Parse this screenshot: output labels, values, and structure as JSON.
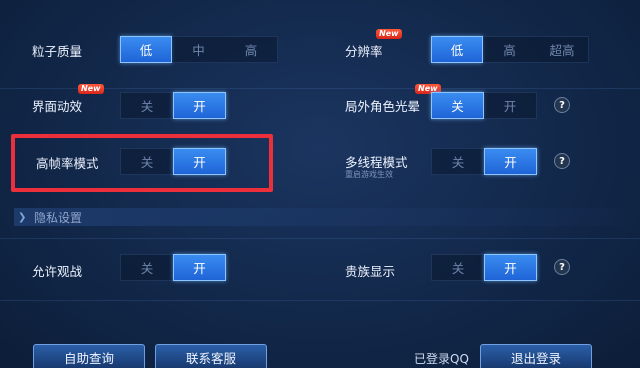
{
  "settings": {
    "particle_quality": {
      "label": "粒子质量",
      "options": [
        "低",
        "中",
        "高"
      ],
      "selected": 0
    },
    "resolution": {
      "label": "分辨率",
      "options": [
        "低",
        "高",
        "超高"
      ],
      "selected": 0,
      "badge": "New"
    },
    "ui_animation": {
      "label": "界面动效",
      "options": [
        "关",
        "开"
      ],
      "selected": 1,
      "badge": "New"
    },
    "outer_glow": {
      "label": "局外角色光晕",
      "options": [
        "关",
        "开"
      ],
      "selected": 0,
      "badge": "New",
      "help": "?"
    },
    "high_fps_mode": {
      "label": "高帧率模式",
      "options": [
        "关",
        "开"
      ],
      "selected": 1
    },
    "multithread_mode": {
      "label": "多线程模式",
      "sublabel": "重启游戏生效",
      "options": [
        "关",
        "开"
      ],
      "selected": 1,
      "help": "?"
    },
    "allow_spectate": {
      "label": "允许观战",
      "options": [
        "关",
        "开"
      ],
      "selected": 1
    },
    "noble_display": {
      "label": "贵族显示",
      "options": [
        "关",
        "开"
      ],
      "selected": 1,
      "help": "?"
    }
  },
  "privacy_section": {
    "title": "隐私设置"
  },
  "footer": {
    "self_service": "自助查询",
    "contact_service": "联系客服",
    "login_status": "已登录QQ",
    "logout": "退出登录"
  },
  "colors": {
    "background": "#12284a",
    "active_option": "#2a76e6",
    "highlight_box": "#ec2f3b",
    "new_badge": "#e8321f"
  }
}
